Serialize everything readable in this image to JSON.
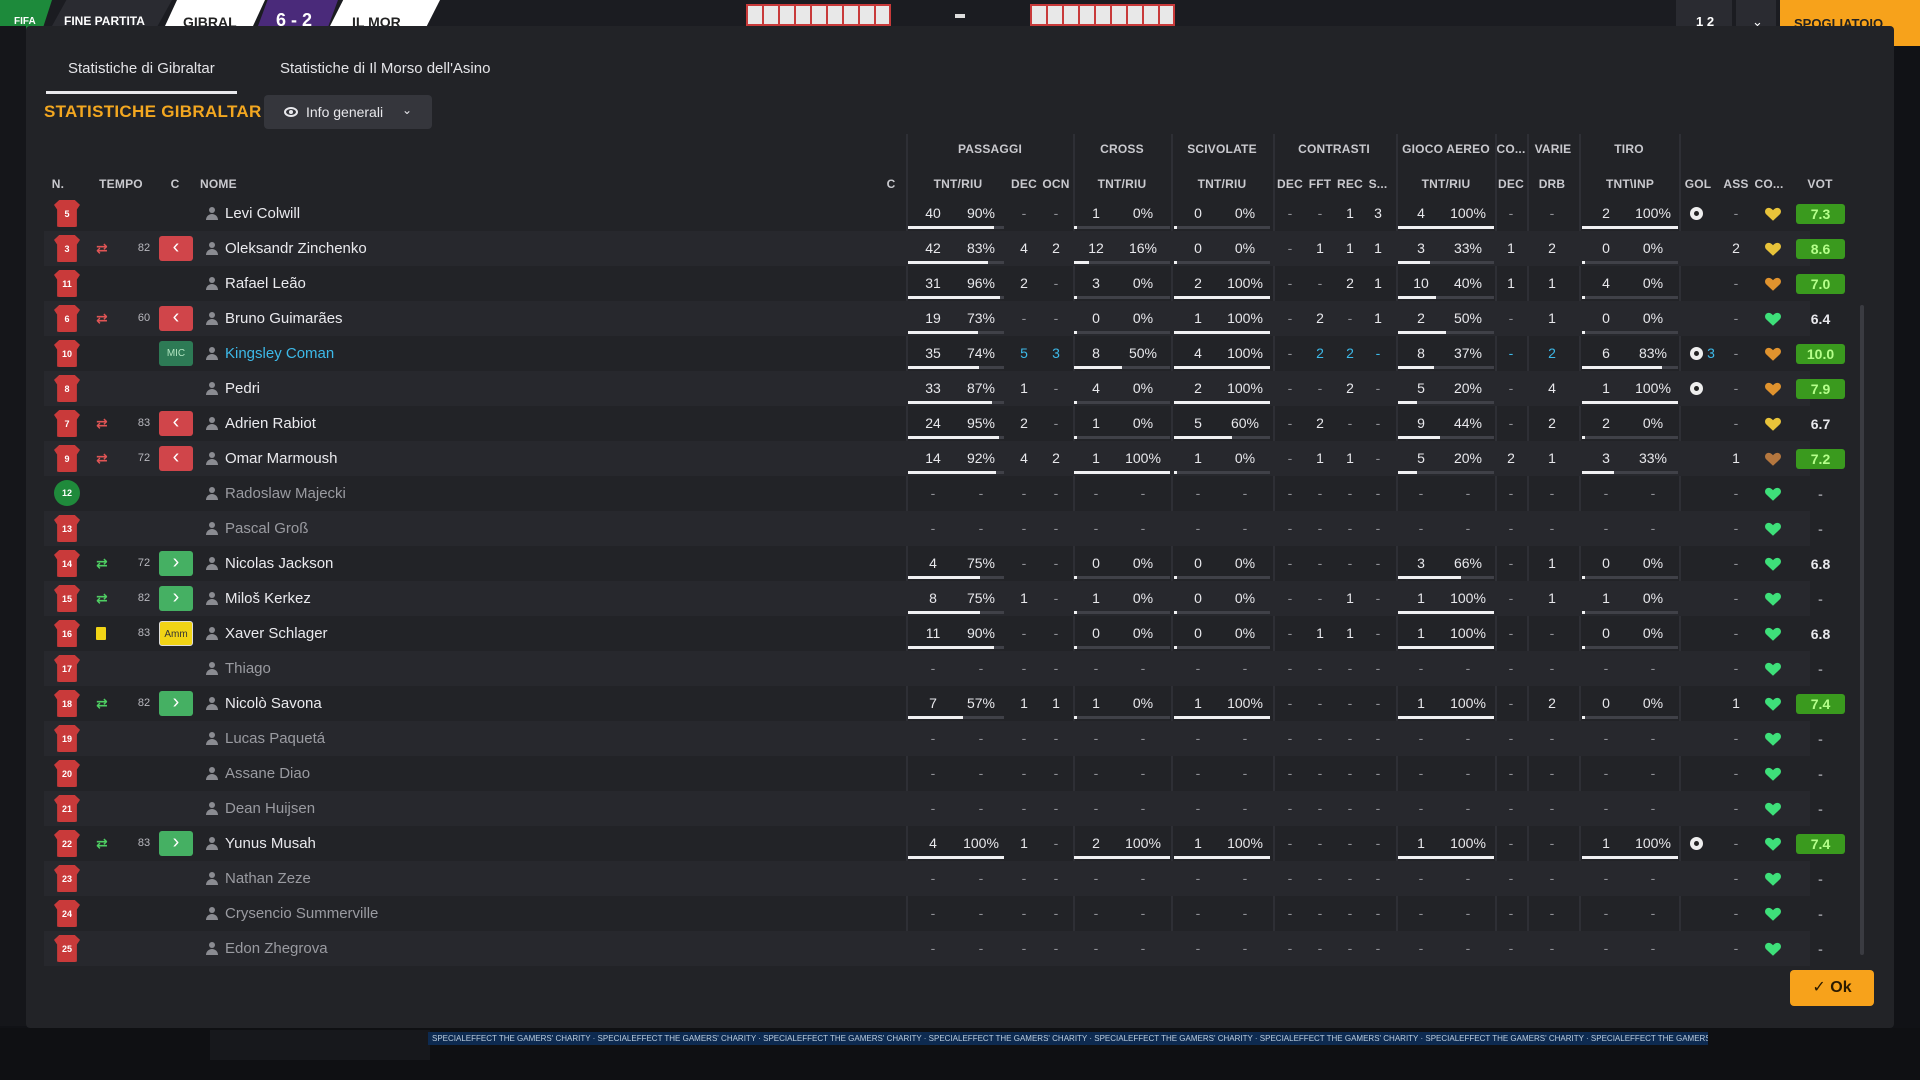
{
  "topbar": {
    "logo": "FIFA",
    "phase": "FINE PARTITA",
    "home": "GIBRAL",
    "score": "6 - 2",
    "away": "IL MOR",
    "btn1": "1 2",
    "btn2": "⌄",
    "action": "SPOGLIATOIO"
  },
  "ad_text": "SPECIALEFFECT THE GAMERS' CHARITY   ·   SPECIALEFFECT THE GAMERS' CHARITY   ·   SPECIALEFFECT THE GAMERS' CHARITY   ·   SPECIALEFFECT THE GAMERS' CHARITY   ·   SPECIALEFFECT THE GAMERS' CHARITY   ·   SPECIALEFFECT THE GAMERS' CHARITY   ·   SPECIALEFFECT THE GAMERS' CHARITY   ·   SPECIALEFFECT THE GAMERS' CHARITY",
  "tabs": [
    "Statistiche di Gibraltar",
    "Statistiche di Il Morso dell'Asino"
  ],
  "title": "STATISTICHE GIBRALTAR",
  "filter_label": "Info generali",
  "groups": [
    "PASSAGGI",
    "CROSS",
    "SCIVOLATE",
    "CONTRASTI",
    "GIOCO AEREO",
    "CO...",
    "VARIE",
    "TIRO"
  ],
  "cols": {
    "n": "N.",
    "tempo": "TEMPO",
    "c": "C",
    "nome": "NOME",
    "c2": "C",
    "pas": "TNT/RIU",
    "pdec": "DEC",
    "pocn": "OCN",
    "cro": "TNT/RIU",
    "sci": "TNT/RIU",
    "cdec": "DEC",
    "cfft": "FFT",
    "crec": "REC",
    "cs": "S...",
    "aer": "TNT/RIU",
    "codec": "DEC",
    "drb": "DRB",
    "tiro": "TNT\\INP",
    "gol": "GOL",
    "ass": "ASS",
    "co": "CO...",
    "vot": "VOT"
  },
  "ok_label": "Ok",
  "players": [
    {
      "num": "5",
      "name": "Levi Colwill",
      "c": [
        "40",
        "90%",
        "-",
        "-",
        "1",
        "0%",
        "0",
        "0%",
        "-",
        "-",
        "1",
        "3",
        "4",
        "100%",
        "-",
        "-",
        "2",
        "100%",
        "",
        "-"
      ],
      "gol": true,
      "goln": "",
      "ass": "-",
      "heart": "yellow",
      "vot": "7.3",
      "vg": true
    },
    {
      "num": "3",
      "sub": "out",
      "tempo": "82",
      "role": "out",
      "name": "Oleksandr Zinchenko",
      "c": [
        "42",
        "83%",
        "4",
        "2",
        "12",
        "16%",
        "0",
        "0%",
        "-",
        "1",
        "1",
        "1",
        "3",
        "33%",
        "1",
        "2",
        "0",
        "0%",
        "",
        ""
      ],
      "ass": "2",
      "heart": "yellow",
      "vot": "8.6",
      "vg": true
    },
    {
      "num": "11",
      "name": "Rafael Leão",
      "c": [
        "31",
        "96%",
        "2",
        "-",
        "3",
        "0%",
        "2",
        "100%",
        "-",
        "-",
        "2",
        "1",
        "10",
        "40%",
        "1",
        "1",
        "4",
        "0%",
        "",
        ""
      ],
      "ass": "-",
      "heart": "orange",
      "vot": "7.0",
      "vg": true
    },
    {
      "num": "6",
      "sub": "out",
      "tempo": "60",
      "role": "out",
      "name": "Bruno Guimarães",
      "c": [
        "19",
        "73%",
        "-",
        "-",
        "0",
        "0%",
        "1",
        "100%",
        "-",
        "2",
        "-",
        "1",
        "2",
        "50%",
        "-",
        "1",
        "0",
        "0%",
        "",
        ""
      ],
      "ass": "-",
      "heart": "green",
      "vot": "6.4"
    },
    {
      "num": "10",
      "role": "mic",
      "role_label": "MIC",
      "name": "Kingsley Coman",
      "blue": true,
      "c": [
        "35",
        "74%",
        "5",
        "3",
        "8",
        "50%",
        "4",
        "100%",
        "-",
        "2",
        "2",
        "-",
        "8",
        "37%",
        "-",
        "2",
        "6",
        "83%",
        "",
        ""
      ],
      "gol": true,
      "goln": "3",
      "ass": "-",
      "heart": "orange",
      "vot": "10.0",
      "vg": true
    },
    {
      "num": "8",
      "name": "Pedri",
      "c": [
        "33",
        "87%",
        "1",
        "-",
        "4",
        "0%",
        "2",
        "100%",
        "-",
        "-",
        "2",
        "-",
        "5",
        "20%",
        "-",
        "4",
        "1",
        "100%",
        "",
        ""
      ],
      "gol": true,
      "goln": "",
      "ass": "-",
      "heart": "orange",
      "vot": "7.9",
      "vg": true
    },
    {
      "num": "7",
      "sub": "out",
      "tempo": "83",
      "role": "out",
      "name": "Adrien Rabiot",
      "c": [
        "24",
        "95%",
        "2",
        "-",
        "1",
        "0%",
        "5",
        "60%",
        "-",
        "2",
        "-",
        "-",
        "9",
        "44%",
        "-",
        "2",
        "2",
        "0%",
        "",
        ""
      ],
      "ass": "-",
      "heart": "yellow",
      "vot": "6.7"
    },
    {
      "num": "9",
      "sub": "out",
      "tempo": "72",
      "role": "out",
      "name": "Omar Marmoush",
      "c": [
        "14",
        "92%",
        "4",
        "2",
        "1",
        "100%",
        "1",
        "0%",
        "-",
        "1",
        "1",
        "-",
        "5",
        "20%",
        "2",
        "1",
        "3",
        "33%",
        "",
        ""
      ],
      "ass": "1",
      "heart": "brown",
      "vot": "7.2",
      "vg": true
    },
    {
      "num": "12",
      "gk": true,
      "name": "Radoslaw Majecki",
      "dim": true,
      "c": [
        "-",
        "-",
        "-",
        "-",
        "-",
        "-",
        "-",
        "-",
        "-",
        "-",
        "-",
        "-",
        "-",
        "-",
        "-",
        "-",
        "-",
        "-",
        "",
        ""
      ],
      "ass": "-",
      "heart": "green",
      "vot": "-"
    },
    {
      "num": "13",
      "name": "Pascal Groß",
      "dim": true,
      "c": [
        "-",
        "-",
        "-",
        "-",
        "-",
        "-",
        "-",
        "-",
        "-",
        "-",
        "-",
        "-",
        "-",
        "-",
        "-",
        "-",
        "-",
        "-",
        "",
        ""
      ],
      "ass": "-",
      "heart": "green",
      "vot": "-"
    },
    {
      "num": "14",
      "sub": "in",
      "tempo": "72",
      "role": "in",
      "name": "Nicolas Jackson",
      "c": [
        "4",
        "75%",
        "-",
        "-",
        "0",
        "0%",
        "0",
        "0%",
        "-",
        "-",
        "-",
        "-",
        "3",
        "66%",
        "-",
        "1",
        "0",
        "0%",
        "",
        ""
      ],
      "ass": "-",
      "heart": "green",
      "vot": "6.8"
    },
    {
      "num": "15",
      "sub": "in",
      "tempo": "82",
      "role": "in",
      "name": "Miloš Kerkez",
      "c": [
        "8",
        "75%",
        "1",
        "-",
        "1",
        "0%",
        "0",
        "0%",
        "-",
        "-",
        "1",
        "-",
        "1",
        "100%",
        "-",
        "1",
        "1",
        "0%",
        "",
        ""
      ],
      "ass": "-",
      "heart": "green",
      "vot": "-"
    },
    {
      "num": "16",
      "card": "yellow",
      "tempo": "83",
      "role": "amm",
      "role_label": "Amm",
      "name": "Xaver Schlager",
      "c": [
        "11",
        "90%",
        "-",
        "-",
        "0",
        "0%",
        "0",
        "0%",
        "-",
        "1",
        "1",
        "-",
        "1",
        "100%",
        "-",
        "-",
        "0",
        "0%",
        "",
        ""
      ],
      "ass": "-",
      "heart": "green",
      "vot": "6.8"
    },
    {
      "num": "17",
      "name": "Thiago",
      "dim": true,
      "c": [
        "-",
        "-",
        "-",
        "-",
        "-",
        "-",
        "-",
        "-",
        "-",
        "-",
        "-",
        "-",
        "-",
        "-",
        "-",
        "-",
        "-",
        "-",
        "",
        ""
      ],
      "ass": "-",
      "heart": "green",
      "vot": "-"
    },
    {
      "num": "18",
      "sub": "in",
      "tempo": "82",
      "role": "in",
      "name": "Nicolò Savona",
      "c": [
        "7",
        "57%",
        "1",
        "1",
        "1",
        "0%",
        "1",
        "100%",
        "-",
        "-",
        "-",
        "-",
        "1",
        "100%",
        "-",
        "2",
        "0",
        "0%",
        "",
        ""
      ],
      "ass": "1",
      "heart": "green",
      "vot": "7.4",
      "vg": true
    },
    {
      "num": "19",
      "name": "Lucas Paquetá",
      "dim": true,
      "c": [
        "-",
        "-",
        "-",
        "-",
        "-",
        "-",
        "-",
        "-",
        "-",
        "-",
        "-",
        "-",
        "-",
        "-",
        "-",
        "-",
        "-",
        "-",
        "",
        ""
      ],
      "ass": "-",
      "heart": "green",
      "vot": "-"
    },
    {
      "num": "20",
      "name": "Assane Diao",
      "dim": true,
      "c": [
        "-",
        "-",
        "-",
        "-",
        "-",
        "-",
        "-",
        "-",
        "-",
        "-",
        "-",
        "-",
        "-",
        "-",
        "-",
        "-",
        "-",
        "-",
        "",
        ""
      ],
      "ass": "-",
      "heart": "green",
      "vot": "-"
    },
    {
      "num": "21",
      "name": "Dean Huijsen",
      "dim": true,
      "c": [
        "-",
        "-",
        "-",
        "-",
        "-",
        "-",
        "-",
        "-",
        "-",
        "-",
        "-",
        "-",
        "-",
        "-",
        "-",
        "-",
        "-",
        "-",
        "",
        ""
      ],
      "ass": "-",
      "heart": "green",
      "vot": "-"
    },
    {
      "num": "22",
      "sub": "in",
      "tempo": "83",
      "role": "in",
      "name": "Yunus Musah",
      "c": [
        "4",
        "100%",
        "1",
        "-",
        "2",
        "100%",
        "1",
        "100%",
        "-",
        "-",
        "-",
        "-",
        "1",
        "100%",
        "-",
        "-",
        "1",
        "100%",
        "",
        ""
      ],
      "gol": true,
      "goln": "",
      "ass": "-",
      "heart": "green",
      "vot": "7.4",
      "vg": true
    },
    {
      "num": "23",
      "name": "Nathan Zeze",
      "dim": true,
      "c": [
        "-",
        "-",
        "-",
        "-",
        "-",
        "-",
        "-",
        "-",
        "-",
        "-",
        "-",
        "-",
        "-",
        "-",
        "-",
        "-",
        "-",
        "-",
        "",
        ""
      ],
      "ass": "-",
      "heart": "green",
      "vot": "-"
    },
    {
      "num": "24",
      "name": "Crysencio Summerville",
      "dim": true,
      "c": [
        "-",
        "-",
        "-",
        "-",
        "-",
        "-",
        "-",
        "-",
        "-",
        "-",
        "-",
        "-",
        "-",
        "-",
        "-",
        "-",
        "-",
        "-",
        "",
        ""
      ],
      "ass": "-",
      "heart": "green",
      "vot": "-"
    },
    {
      "num": "25",
      "name": "Edon Zhegrova",
      "dim": true,
      "c": [
        "-",
        "-",
        "-",
        "-",
        "-",
        "-",
        "-",
        "-",
        "-",
        "-",
        "-",
        "-",
        "-",
        "-",
        "-",
        "-",
        "-",
        "-",
        "",
        ""
      ],
      "ass": "-",
      "heart": "green",
      "vot": "-"
    }
  ],
  "heart_colors": {
    "green": "#3ee07a",
    "yellow": "#e8c33a",
    "orange": "#e0932e",
    "brown": "#b4773f"
  },
  "accent": "#f7a21b"
}
